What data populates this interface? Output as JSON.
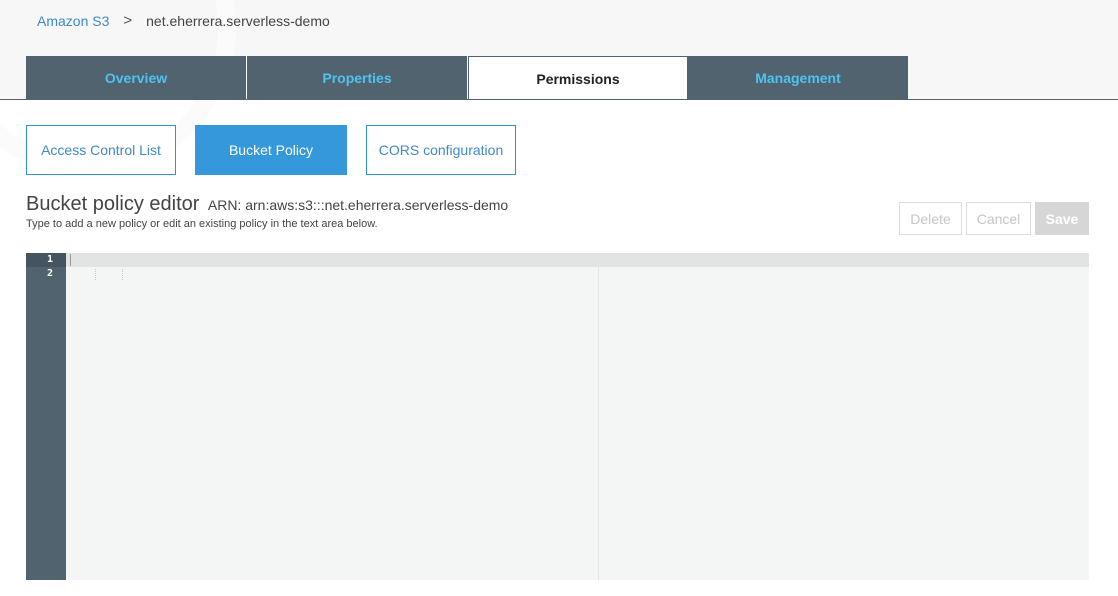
{
  "breadcrumb": {
    "root": "Amazon S3",
    "separator": ">",
    "current": "net.eherrera.serverless-demo"
  },
  "tabs": [
    {
      "label": "Overview",
      "active": false
    },
    {
      "label": "Properties",
      "active": false
    },
    {
      "label": "Permissions",
      "active": true
    },
    {
      "label": "Management",
      "active": false
    }
  ],
  "subtabs": [
    {
      "label": "Access Control List",
      "active": false
    },
    {
      "label": "Bucket Policy",
      "active": true
    },
    {
      "label": "CORS configuration",
      "active": false
    }
  ],
  "editor": {
    "title": "Bucket policy editor",
    "arn": "ARN: arn:aws:s3:::net.eherrera.serverless-demo",
    "description": "Type to add a new policy or edit an existing policy in the text area below.",
    "line_numbers": [
      "1",
      "2"
    ]
  },
  "actions": {
    "delete_label": "Delete",
    "cancel_label": "Cancel",
    "save_label": "Save"
  },
  "colors": {
    "tab_bg": "#50636e",
    "tab_text": "#4ec3ef",
    "accent": "#3498db",
    "link": "#3f8ac4"
  }
}
